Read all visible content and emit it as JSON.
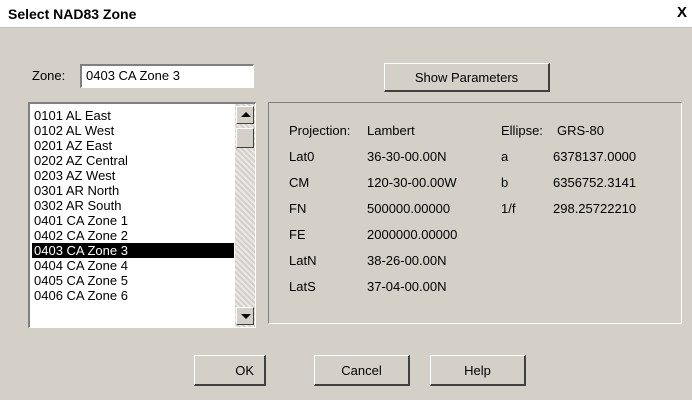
{
  "window": {
    "title": "Select NAD83 Zone",
    "close_glyph": "X"
  },
  "zone": {
    "label": "Zone:",
    "value": "0403 CA Zone 3"
  },
  "buttons": {
    "show_parameters": "Show Parameters",
    "ok": "OK",
    "cancel": "Cancel",
    "help": "Help"
  },
  "zone_list": {
    "items": [
      "0101 AL East",
      "0102 AL West",
      "0201 AZ East",
      "0202 AZ Central",
      "0203 AZ West",
      "0301 AR North",
      "0302 AR South",
      "0401 CA Zone 1",
      "0402 CA Zone 2",
      "0403 CA Zone 3",
      "0404 CA Zone 4",
      "0405 CA Zone 5",
      "0406 CA Zone 6"
    ],
    "selected_index": 9
  },
  "parameters": {
    "left": [
      {
        "label": "Projection:",
        "value": "Lambert"
      },
      {
        "label": "Lat0",
        "value": "36-30-00.00N"
      },
      {
        "label": "CM",
        "value": "120-30-00.00W"
      },
      {
        "label": "FN",
        "value": "500000.00000"
      },
      {
        "label": "FE",
        "value": "2000000.00000"
      },
      {
        "label": "LatN",
        "value": "38-26-00.00N"
      },
      {
        "label": "LatS",
        "value": "37-04-00.00N"
      }
    ],
    "right": [
      {
        "label": "Ellipse:",
        "value": "GRS-80"
      },
      {
        "label": "a",
        "value": "6378137.0000"
      },
      {
        "label": "b",
        "value": "6356752.3141"
      },
      {
        "label": "1/f",
        "value": "298.25722210"
      }
    ]
  }
}
